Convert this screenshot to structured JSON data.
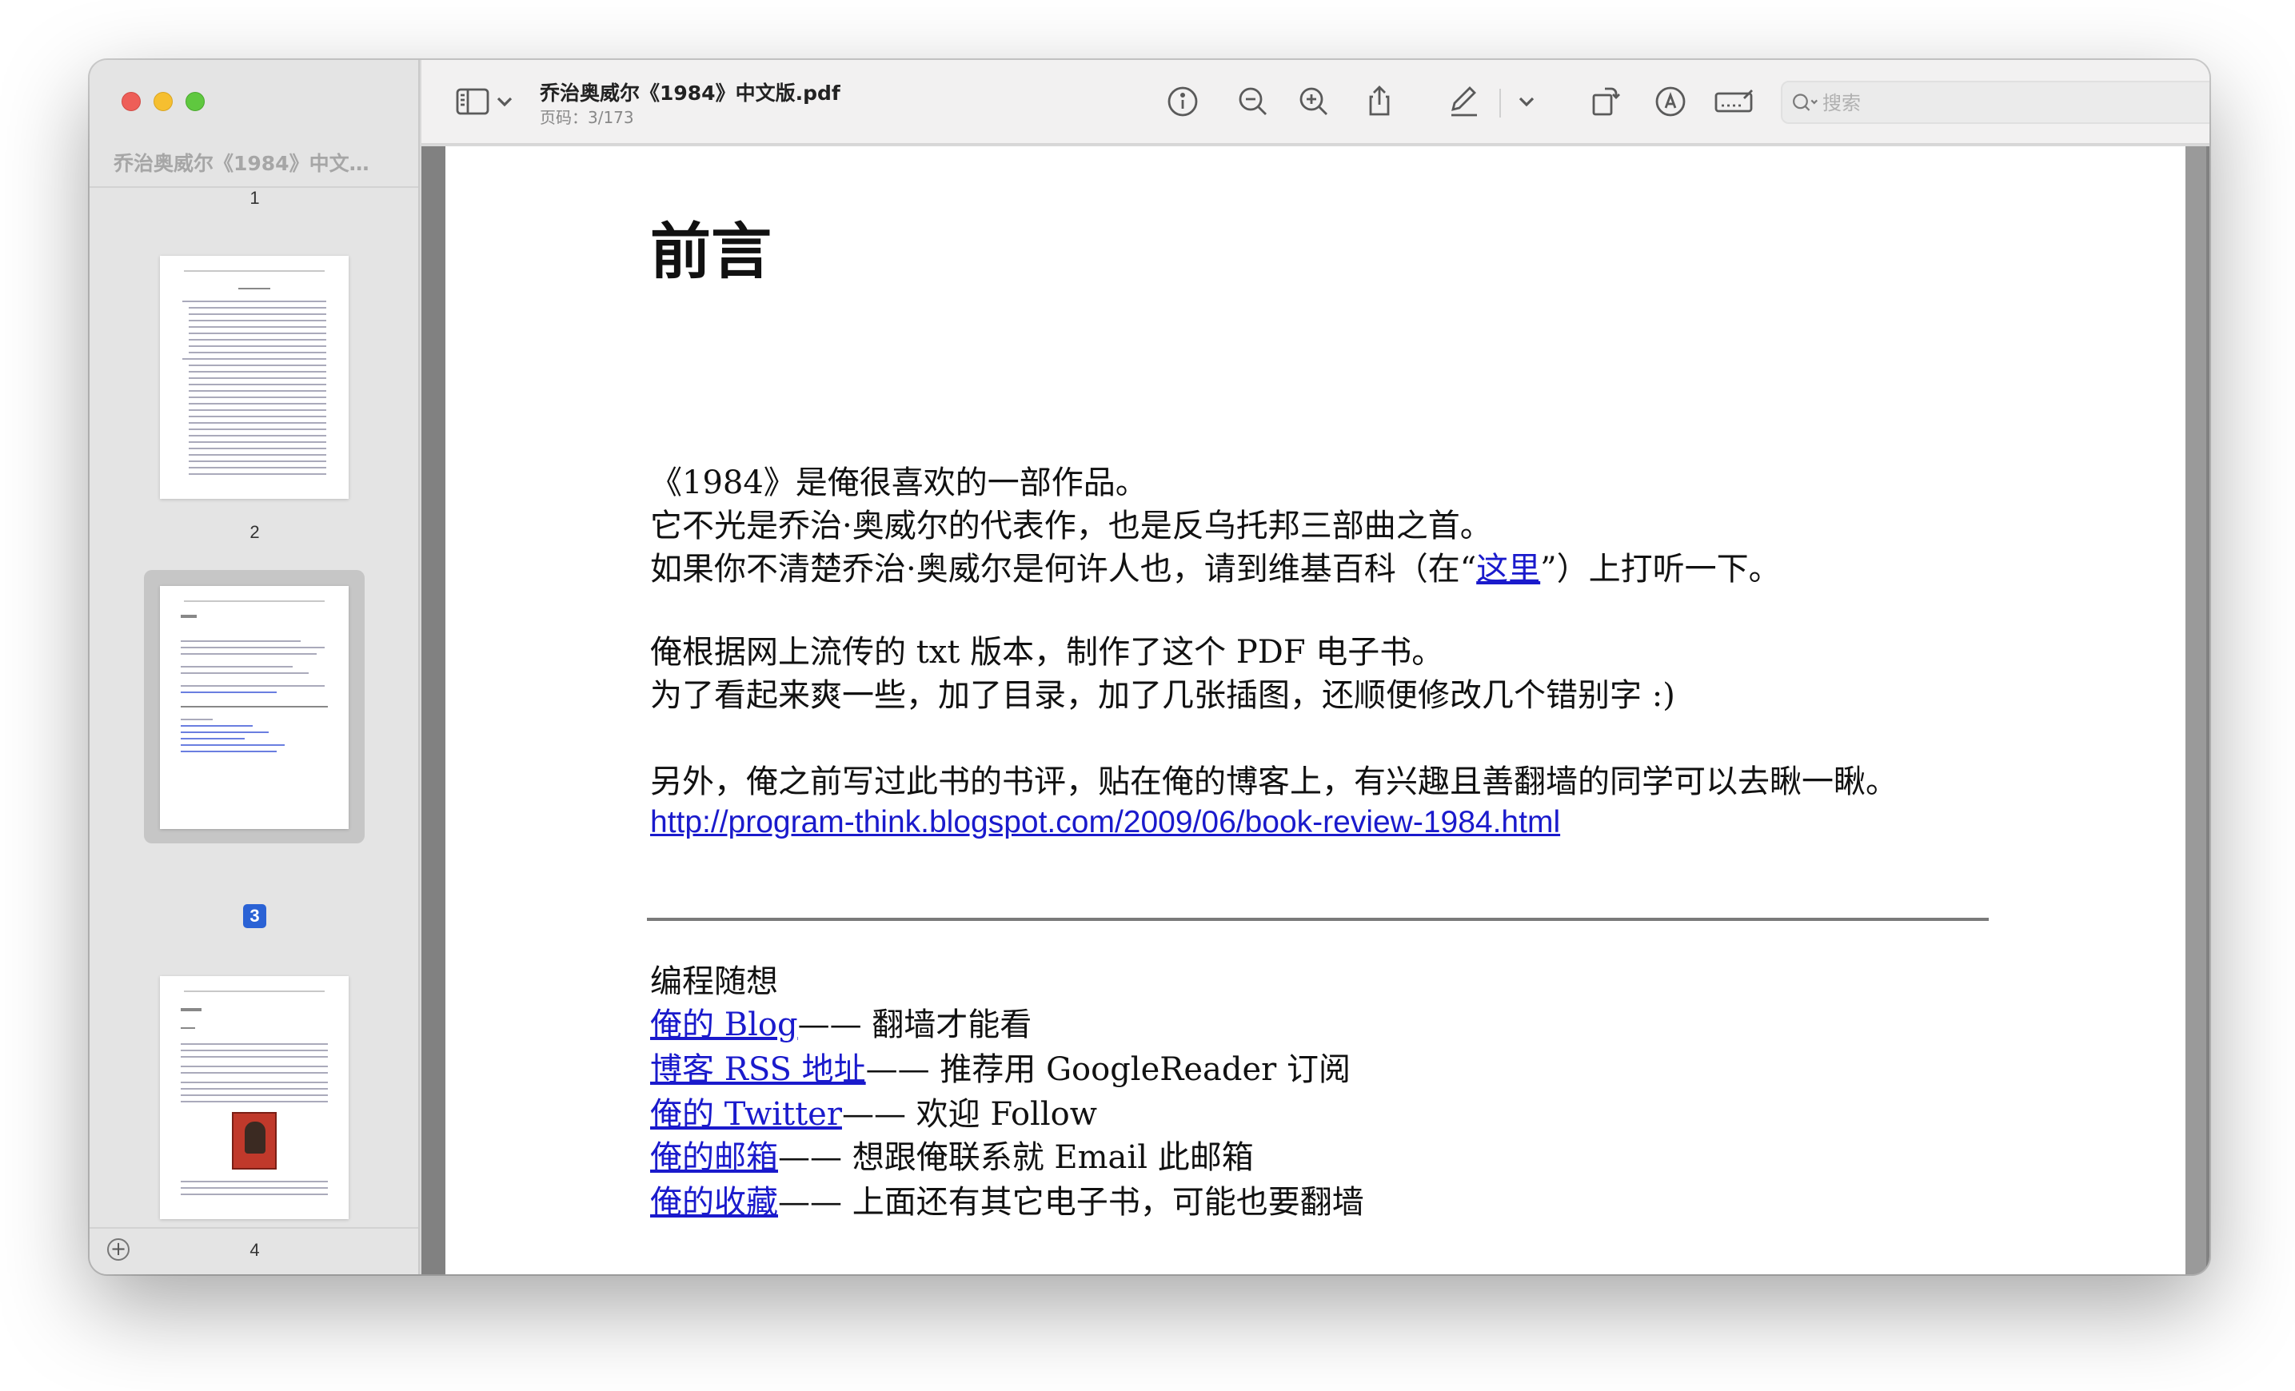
{
  "window": {
    "traffic_lights": [
      "close",
      "minimize",
      "zoom"
    ]
  },
  "sidebar": {
    "title": "乔治奥威尔《1984》中文…",
    "pages": [
      {
        "number": "1",
        "selected": false
      },
      {
        "number": "2",
        "selected": false
      },
      {
        "number": "3",
        "selected": true
      },
      {
        "number": "4",
        "selected": false
      }
    ],
    "add_icon": "plus-circle-icon"
  },
  "toolbar": {
    "doc_title": "乔治奥威尔《1984》中文版.pdf",
    "page_info": "页码：3/173",
    "icons": [
      "sidebar-toggle-icon",
      "chevron-down-icon",
      "info-icon",
      "zoom-out-icon",
      "zoom-in-icon",
      "share-icon",
      "markup-pen-icon",
      "chevron-down-icon",
      "rotate-icon",
      "annotate-icon",
      "sign-icon",
      "search-icon"
    ],
    "search_placeholder": "搜索"
  },
  "page": {
    "title": "前言",
    "para1": [
      "《1984》是俺很喜欢的一部作品。",
      "它不光是乔治·奥威尔的代表作，也是反乌托邦三部曲之首。"
    ],
    "para1_line3_before": "如果你不清楚乔治·奥威尔是何许人也，请到维基百科（在“",
    "para1_line3_link": "这里",
    "para1_line3_after": "”）上打听一下。",
    "para2": [
      "俺根据网上流传的 txt 版本，制作了这个 PDF 电子书。",
      "为了看起来爽一些，加了目录，加了几张插图，还顺便修改几个错别字 :)"
    ],
    "para3": "另外，俺之前写过此书的书评，贴在俺的博客上，有兴趣且善翻墙的同学可以去瞅一瞅。",
    "review_url": "http://program-think.blogspot.com/2009/06/book-review-1984.html",
    "footer_heading": "编程随想",
    "footer_links": [
      {
        "link": "俺的 Blog",
        "desc": "—— 翻墙才能看"
      },
      {
        "link": "博客 RSS 地址",
        "desc": "—— 推荐用 GoogleReader 订阅"
      },
      {
        "link": "俺的 Twitter",
        "desc": "—— 欢迎 Follow"
      },
      {
        "link": "俺的邮箱",
        "desc": "—— 想跟俺联系就 Email 此邮箱"
      },
      {
        "link": "俺的收藏",
        "desc": "—— 上面还有其它电子书，可能也要翻墙"
      }
    ]
  },
  "colors": {
    "link": "#1a1acc",
    "selection": "#2a62d5",
    "doc_background": "#818181"
  }
}
